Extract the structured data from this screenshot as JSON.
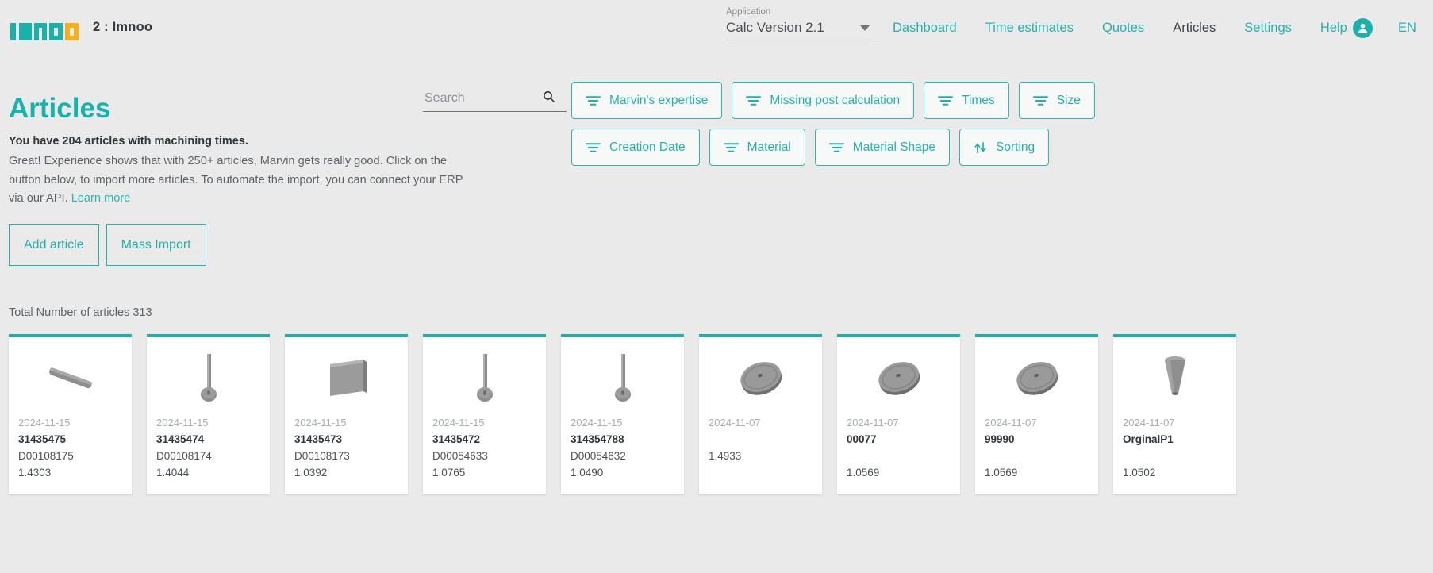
{
  "header": {
    "logo_text": "imnoo",
    "tenant": "2 : Imnoo",
    "app_select": {
      "label": "Application",
      "value": "Calc Version 2.1",
      "caret_icon": "chevron-down-icon"
    },
    "nav": [
      {
        "label": "Dashboard",
        "active": false
      },
      {
        "label": "Time estimates",
        "active": false
      },
      {
        "label": "Quotes",
        "active": false
      },
      {
        "label": "Articles",
        "active": true
      },
      {
        "label": "Settings",
        "active": false
      },
      {
        "label": "Help",
        "active": false
      }
    ],
    "avatar_icon": "user-avatar-icon",
    "language": "EN"
  },
  "main": {
    "page_title": "Articles",
    "lead": "You have 204 articles with machining times.",
    "body_line_1": "Great! Experience shows that with 250+ articles, Marvin gets really good. Click on",
    "body_line_2": "the button below, to import more articles. To automate the import, you can",
    "body_line_3": "connect your ERP via our API. ",
    "learn_more": "Learn more",
    "buttons": [
      {
        "label": "Add article",
        "name": "add-article-button"
      },
      {
        "label": "Mass Import",
        "name": "mass-import-button"
      }
    ],
    "total_label": "Total Number of articles 313"
  },
  "search": {
    "placeholder": "Search",
    "value": "",
    "icon": "search-icon"
  },
  "filters": [
    {
      "label": "Marvin's expertise",
      "icon": "filter-icon"
    },
    {
      "label": "Missing post calculation",
      "icon": "filter-icon"
    },
    {
      "label": "Times",
      "icon": "filter-icon"
    },
    {
      "label": "Size",
      "icon": "filter-icon"
    },
    {
      "label": "Creation Date",
      "icon": "filter-icon"
    },
    {
      "label": "Material",
      "icon": "filter-icon"
    },
    {
      "label": "Material Shape",
      "icon": "filter-icon"
    },
    {
      "label": "Sorting",
      "icon": "sort-arrows-icon"
    }
  ],
  "cards": [
    {
      "date": "2024-11-15",
      "article_id": "31435475",
      "drawing": "D00108175",
      "material": "1.4303",
      "shape": "rod"
    },
    {
      "date": "2024-11-15",
      "article_id": "31435474",
      "drawing": "D00108174",
      "material": "1.4044",
      "shape": "pin"
    },
    {
      "date": "2024-11-15",
      "article_id": "31435473",
      "drawing": "D00108173",
      "material": "1.0392",
      "shape": "plate"
    },
    {
      "date": "2024-11-15",
      "article_id": "31435472",
      "drawing": "D00054633",
      "material": "1.0765",
      "shape": "pin"
    },
    {
      "date": "2024-11-15",
      "article_id": "314354788",
      "drawing": "D00054632",
      "material": "1.0490",
      "shape": "pin"
    },
    {
      "date": "2024-11-07",
      "article_id": "",
      "drawing": "",
      "material": "1.4933",
      "shape": "disc"
    },
    {
      "date": "2024-11-07",
      "article_id": "00077",
      "drawing": "",
      "material": "1.0569",
      "shape": "disc"
    },
    {
      "date": "2024-11-07",
      "article_id": "99990",
      "drawing": "",
      "material": "1.0569",
      "shape": "disc"
    },
    {
      "date": "2024-11-07",
      "article_id": "OrginalP1",
      "drawing": "",
      "material": "1.0502",
      "shape": "cone"
    }
  ],
  "colors": {
    "accent_teal": "#19b2ab",
    "logo_amber": "#f9b016",
    "page_bg": "#eaeaea",
    "card_bg": "#ffffff",
    "text_dark": "#2f363c",
    "text_muted": "#5d6469"
  }
}
